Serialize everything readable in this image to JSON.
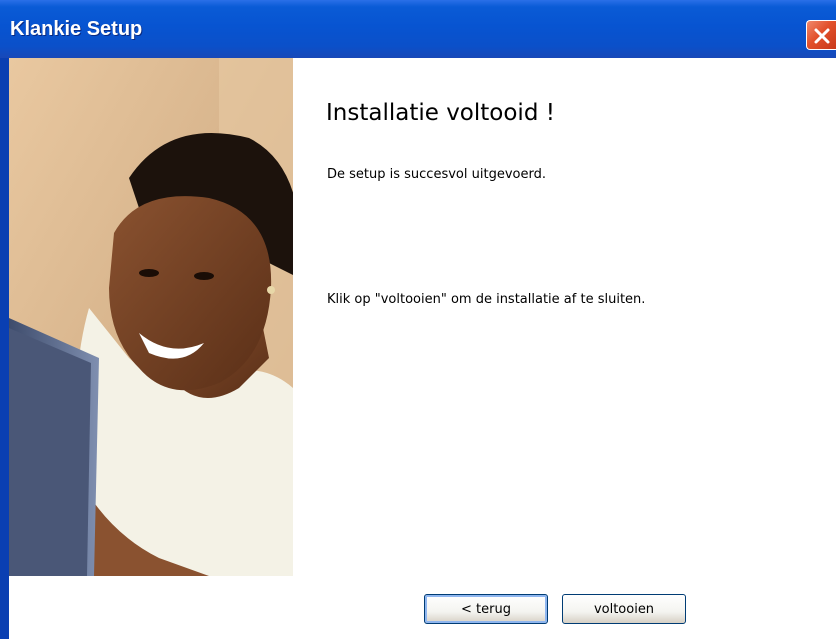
{
  "window": {
    "title": "Klankie Setup"
  },
  "content": {
    "heading": "Installatie voltooid !",
    "success_text": "De setup is succesvol uitgevoerd.",
    "instruction_text": "Klik op \"voltooien\" om de installatie af te sluiten."
  },
  "buttons": {
    "back_label": "< terug",
    "finish_label": "voltooien"
  },
  "icons": {
    "close": "close-icon",
    "side_image": "woman-at-laptop-photo"
  },
  "colors": {
    "titlebar": "#0754d1",
    "close_button": "#e2512b",
    "focus_ring": "#8fb6ef"
  }
}
